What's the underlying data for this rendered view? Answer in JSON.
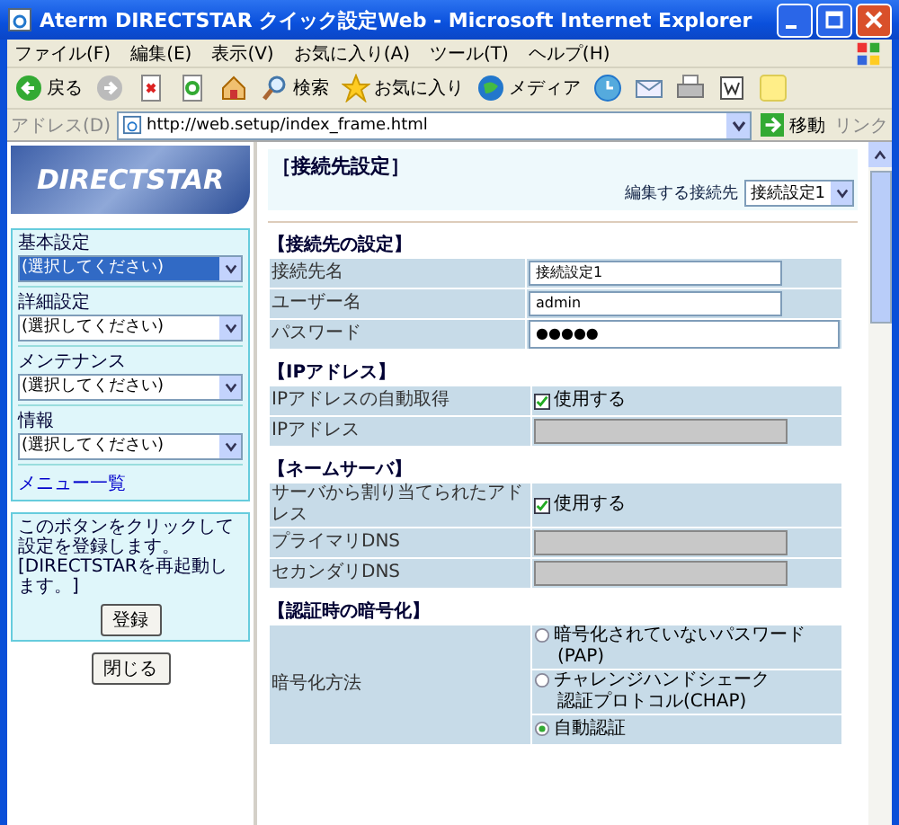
{
  "window": {
    "title": "Aterm DIRECTSTAR クイック設定Web - Microsoft Internet Explorer"
  },
  "menu": [
    "ファイル(F)",
    "編集(E)",
    "表示(V)",
    "お気に入り(A)",
    "ツール(T)",
    "ヘルプ(H)"
  ],
  "toolbar": [
    {
      "kind": "back",
      "label": "戻る"
    },
    {
      "kind": "forward"
    },
    {
      "kind": "stop"
    },
    {
      "kind": "refresh"
    },
    {
      "kind": "home"
    },
    {
      "kind": "search",
      "label": "検索"
    },
    {
      "kind": "favorites",
      "label": "お気に入り"
    },
    {
      "kind": "media",
      "label": "メディア"
    },
    {
      "kind": "history"
    },
    {
      "kind": "mail"
    },
    {
      "kind": "print"
    },
    {
      "kind": "edit"
    },
    {
      "kind": "note"
    }
  ],
  "address": {
    "label": "アドレス(D)",
    "url": "http://web.setup/index_frame.html",
    "go": "移動",
    "links": "リンク"
  },
  "sidebar": {
    "logo": "DIRECTSTAR",
    "selects": [
      {
        "label": "基本設定",
        "value": "(選択してください)",
        "focused": true
      },
      {
        "label": "詳細設定",
        "value": "(選択してください)",
        "focused": false
      },
      {
        "label": "メンテナンス",
        "value": "(選択してください)",
        "focused": false
      },
      {
        "label": "情報",
        "value": "(選択してください)",
        "focused": false
      }
    ],
    "menu_link": "メニュー一覧",
    "note": "このボタンをクリックして設定を登録します。[DIRECTSTARを再起動します。]",
    "register": "登録",
    "close": "閉じる"
  },
  "main": {
    "title": "［接続先設定］",
    "edit_label": "編集する接続先",
    "edit_value": "接続設定1",
    "sections": [
      {
        "title": "【接続先の設定】",
        "rows": [
          {
            "label": "接続先名",
            "kind": "text",
            "value": "接続設定1",
            "disabled": false
          },
          {
            "label": "ユーザー名",
            "kind": "text",
            "value": "admin",
            "disabled": false
          },
          {
            "label": "パスワード",
            "kind": "password",
            "value": "●●●●●",
            "disabled": false
          }
        ]
      },
      {
        "title": "【IPアドレス】",
        "rows": [
          {
            "label": "IPアドレスの自動取得",
            "kind": "checkbox",
            "value": "使用する",
            "checked": true
          },
          {
            "label": "IPアドレス",
            "kind": "text",
            "disabled": true
          }
        ]
      },
      {
        "title": "【ネームサーバ】",
        "rows": [
          {
            "label": "サーバから割り当てられたアドレス",
            "kind": "checkbox",
            "value": "使用する",
            "checked": true
          },
          {
            "label": "プライマリDNS",
            "kind": "text",
            "disabled": true
          },
          {
            "label": "セカンダリDNS",
            "kind": "text",
            "disabled": true
          }
        ]
      },
      {
        "title": "【認証時の暗号化】",
        "rows": [
          {
            "label": "暗号化方法",
            "kind": "radio",
            "options": [
              {
                "lines": [
                  "暗号化されていないパスワード",
                  "(PAP)"
                ],
                "selected": false
              },
              {
                "lines": [
                  "チャレンジハンドシェーク",
                  "認証プロトコル(CHAP)"
                ],
                "selected": false
              },
              {
                "lines": [
                  "自動認証"
                ],
                "selected": true
              }
            ]
          }
        ]
      }
    ]
  }
}
